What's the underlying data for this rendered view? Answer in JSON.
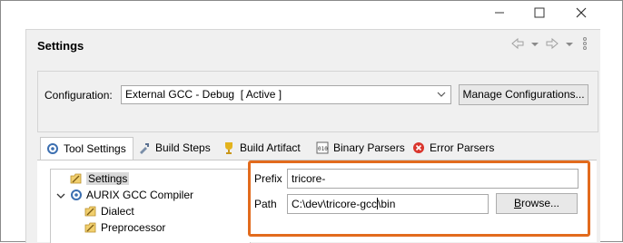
{
  "window": {
    "minimize_glyph": "—",
    "maximize_glyph": "☐",
    "close_glyph": "✕"
  },
  "header": {
    "title": "Settings"
  },
  "configuration": {
    "label": "Configuration:",
    "selected_value": "External GCC - Debug  [ Active ]",
    "manage_button": "Manage Configurations..."
  },
  "tabs": [
    {
      "label": "Tool Settings",
      "icon": "tool-settings-icon",
      "active": true
    },
    {
      "label": "Build Steps",
      "icon": "build-steps-icon",
      "active": false
    },
    {
      "label": "Build Artifact",
      "icon": "build-artifact-icon",
      "active": false
    },
    {
      "label": "Binary Parsers",
      "icon": "binary-parsers-icon",
      "active": false
    },
    {
      "label": "Error Parsers",
      "icon": "error-parsers-icon",
      "active": false
    }
  ],
  "tree": {
    "items": [
      {
        "label": "Settings",
        "icon": "settings-folder-icon",
        "selected": true
      },
      {
        "label": "AURIX GCC Compiler",
        "icon": "compiler-icon",
        "expanded": true
      },
      {
        "label": "Dialect",
        "icon": "settings-folder-icon"
      },
      {
        "label": "Preprocessor",
        "icon": "settings-folder-icon"
      }
    ]
  },
  "fields": {
    "prefix_label": "Prefix",
    "prefix_value": "tricore-",
    "path_label": "Path",
    "path_value_before_caret": "C:\\dev\\tricore-gcc",
    "path_value_after_caret": "\\bin",
    "browse_button_mnemonic": "B",
    "browse_button_rest": "rowse..."
  },
  "colors": {
    "highlight": "#e26b1d",
    "panel_bg": "#f0f0f0"
  }
}
